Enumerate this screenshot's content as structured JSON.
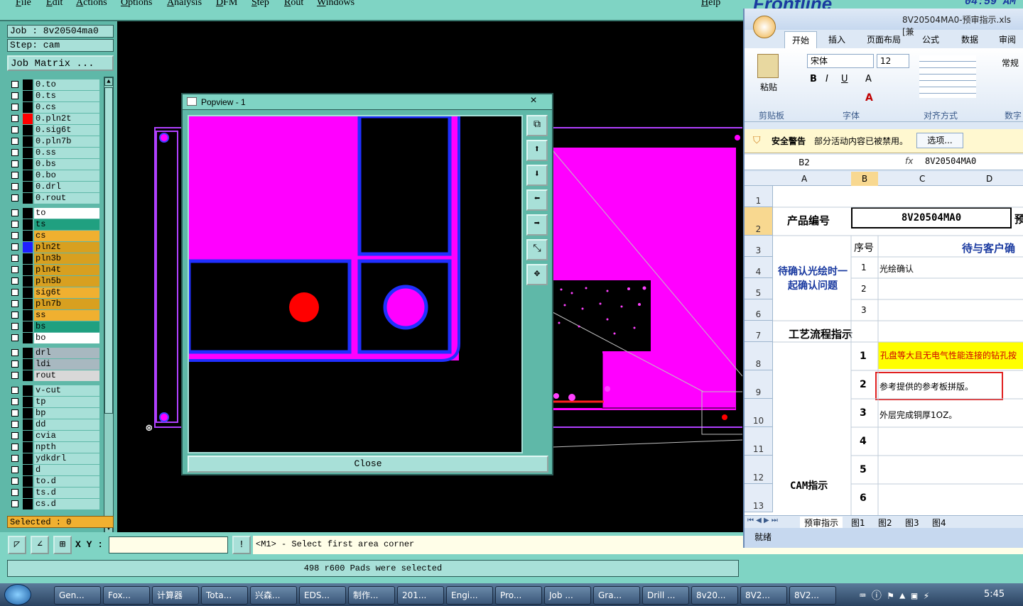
{
  "menu": {
    "items": [
      "File",
      "Edit",
      "Actions",
      "Options",
      "Analysis",
      "DFM",
      "Step",
      "Rout",
      "Windows"
    ],
    "help": "Help",
    "time": "04:59 AM",
    "brand": "Frontline"
  },
  "job": {
    "job_label": "Job : 8v20504ma0",
    "step_label": "Step: cam",
    "matrix_button": "Job Matrix ..."
  },
  "layers": [
    {
      "name": "0.to",
      "color": "#000000"
    },
    {
      "name": "0.ts",
      "color": "#000000"
    },
    {
      "name": "0.cs",
      "color": "#000000"
    },
    {
      "name": "0.pln2t",
      "color": "#ff0000"
    },
    {
      "name": "0.sig6t",
      "color": "#000000"
    },
    {
      "name": "0.pln7b",
      "color": "#000000"
    },
    {
      "name": "0.ss",
      "color": "#000000"
    },
    {
      "name": "0.bs",
      "color": "#000000"
    },
    {
      "name": "0.bo",
      "color": "#000000"
    },
    {
      "name": "0.drl",
      "color": "#000000"
    },
    {
      "name": "0.rout",
      "color": "#000000"
    },
    {
      "name": "to",
      "color": "#000000",
      "bg": "#ffffff"
    },
    {
      "name": "ts",
      "color": "#000000",
      "bg": "#20a080"
    },
    {
      "name": "cs",
      "color": "#000000",
      "bg": "#f0b030"
    },
    {
      "name": "pln2t",
      "color": "#2020ff",
      "bg": "#d8a020"
    },
    {
      "name": "pln3b",
      "color": "#000000",
      "bg": "#d8a020"
    },
    {
      "name": "pln4t",
      "color": "#000000",
      "bg": "#d8a020"
    },
    {
      "name": "pln5b",
      "color": "#000000",
      "bg": "#d8a020"
    },
    {
      "name": "sig6t",
      "color": "#000000",
      "bg": "#f0b030"
    },
    {
      "name": "pln7b",
      "color": "#000000",
      "bg": "#d8a020"
    },
    {
      "name": "ss",
      "color": "#000000",
      "bg": "#f0b030"
    },
    {
      "name": "bs",
      "color": "#000000",
      "bg": "#20a080"
    },
    {
      "name": "bo",
      "color": "#000000",
      "bg": "#ffffff"
    },
    {
      "name": "drl",
      "color": "#000000",
      "bg": "#a8b8c0"
    },
    {
      "name": "ldi",
      "color": "#000000",
      "bg": "#a8b8c0"
    },
    {
      "name": "rout",
      "color": "#000000",
      "bg": "#d8d8d8"
    },
    {
      "name": "v-cut",
      "color": "#000000"
    },
    {
      "name": "tp",
      "color": "#000000"
    },
    {
      "name": "bp",
      "color": "#000000"
    },
    {
      "name": "dd",
      "color": "#000000"
    },
    {
      "name": "cvia",
      "color": "#000000"
    },
    {
      "name": "npth",
      "color": "#000000"
    },
    {
      "name": "ydkdrl",
      "color": "#000000"
    },
    {
      "name": "d",
      "color": "#000000"
    },
    {
      "name": "to.d",
      "color": "#000000"
    },
    {
      "name": "ts.d",
      "color": "#000000"
    },
    {
      "name": "cs.d",
      "color": "#000000"
    }
  ],
  "selected": "Selected : 0",
  "cmd": {
    "xy_label": "X Y :",
    "xy_value": "",
    "prompt": "<M1> - Select first area corner"
  },
  "status": "498 r600 Pads were selected",
  "popview": {
    "title": "Popview - 1",
    "close": "Close",
    "close_x": "×"
  },
  "excel": {
    "title": "8V20504MA0-预审指示.xls  [兼",
    "tabs": [
      "开始",
      "插入",
      "页面布局",
      "公式",
      "数据",
      "审阅"
    ],
    "font_name": "宋体",
    "font_size": "12",
    "number_format": "常规",
    "groups": [
      "剪贴板",
      "字体",
      "对齐方式",
      "数字"
    ],
    "paste": "粘贴",
    "security_label": "安全警告",
    "security_msg": "部分活动内容已被禁用。",
    "options_button": "选项...",
    "cell_ref": "B2",
    "fx": "fx",
    "formula": "8V20504MA0",
    "columns": [
      "A",
      "B",
      "C",
      "D"
    ],
    "rows": [
      "1",
      "2",
      "3",
      "4",
      "5",
      "6",
      "7",
      "8",
      "9",
      "10",
      "11",
      "12",
      "13"
    ],
    "product_label": "产品编号",
    "product_value": "8V20504MA0",
    "pre_col": "预",
    "seq_header": "序号",
    "confirm_header": "待与客户确",
    "confirm_group": "待确认光绘时一起确认问题",
    "item1": "光绘确认",
    "process": "工艺流程指示",
    "cam": "CAM指示",
    "n1": "1",
    "n2": "2",
    "n3": "3",
    "n4": "4",
    "n5": "5",
    "n6": "6",
    "note1": "孔盘等大且无电气性能连接的钻孔按",
    "note2": "参考提供的参考板拼版。",
    "note3": "外层完成铜厚1OZ。",
    "sheets": [
      "预审指示",
      "图1",
      "图2",
      "图3",
      "图4"
    ],
    "ready": "就绪"
  },
  "taskbar": {
    "items": [
      "Gen...",
      "Fox...",
      "计算器",
      "Tota...",
      "兴森...",
      "EDS...",
      "制作...",
      "201...",
      "Engi...",
      "Pro...",
      "Job ...",
      "Gra...",
      "Drill ...",
      "8v20...",
      "8V2...",
      "8V2..."
    ],
    "clock": "5:45"
  }
}
